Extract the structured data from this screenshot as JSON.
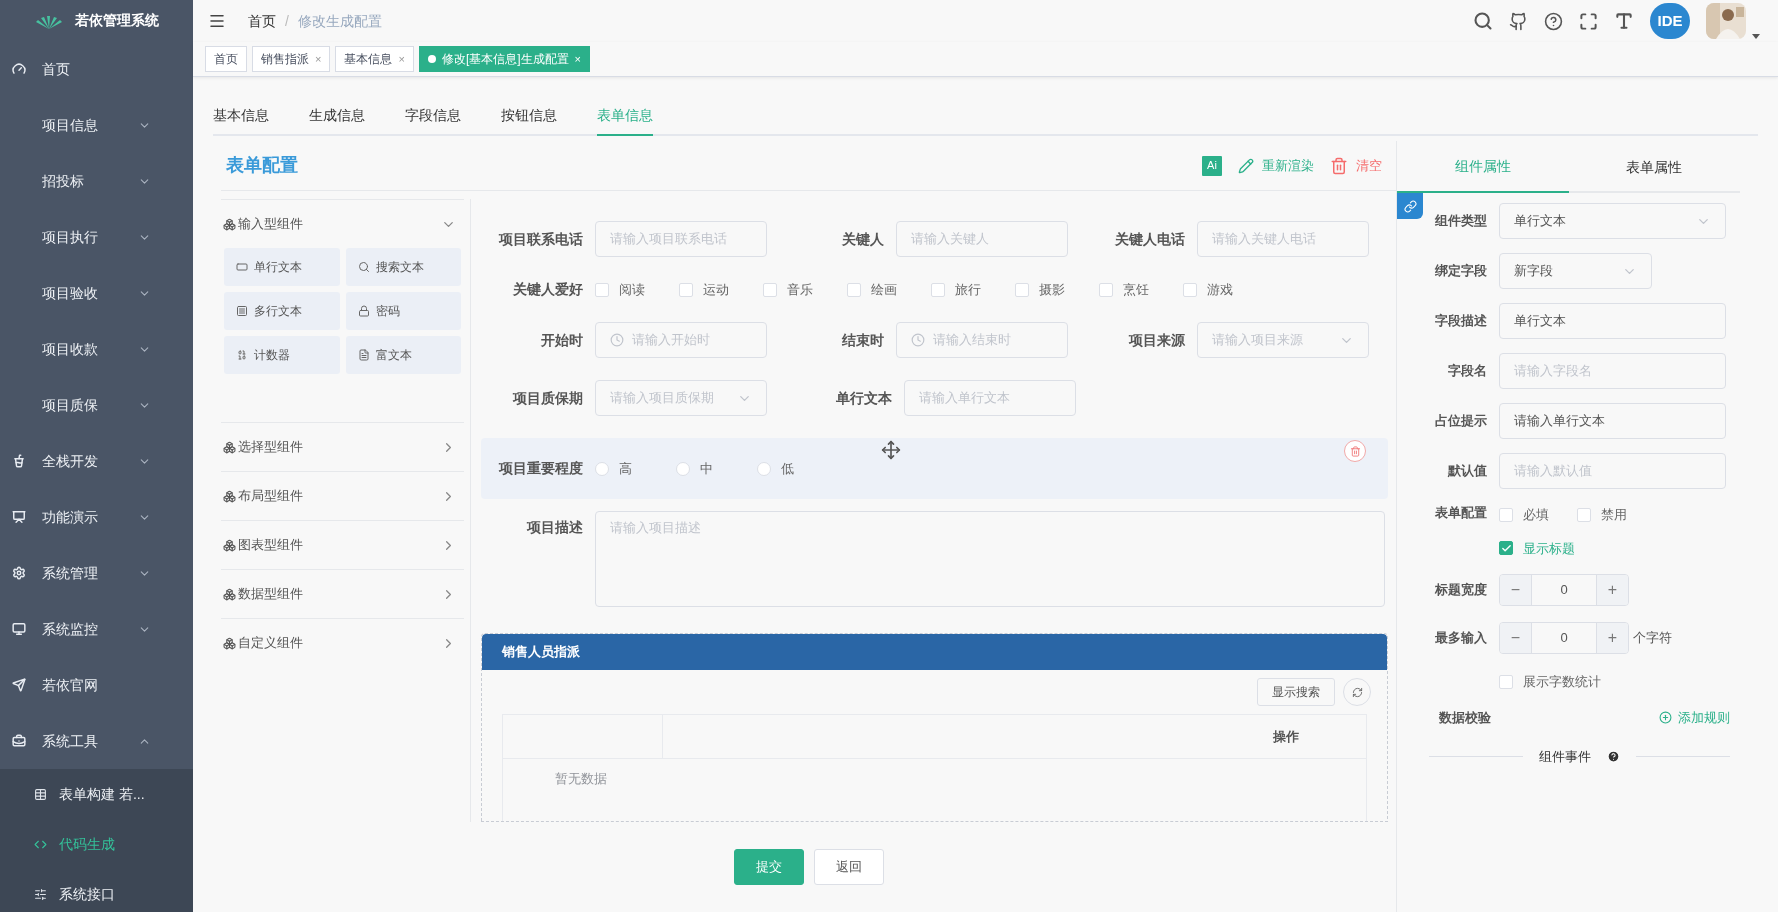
{
  "app": {
    "title": "若依管理系统"
  },
  "sidebar": {
    "items": [
      {
        "label": "首页",
        "kind": "top"
      },
      {
        "label": "项目信息",
        "kind": "plain",
        "expanded": false
      },
      {
        "label": "招投标",
        "kind": "plain",
        "expanded": false
      },
      {
        "label": "项目执行",
        "kind": "plain",
        "expanded": false
      },
      {
        "label": "项目验收",
        "kind": "plain",
        "expanded": false
      },
      {
        "label": "项目收款",
        "kind": "plain",
        "expanded": false
      },
      {
        "label": "项目质保",
        "kind": "plain",
        "expanded": false
      },
      {
        "label": "全栈开发",
        "kind": "top",
        "expanded": false
      },
      {
        "label": "功能演示",
        "kind": "top",
        "expanded": false
      },
      {
        "label": "系统管理",
        "kind": "top",
        "expanded": false
      },
      {
        "label": "系统监控",
        "kind": "top",
        "expanded": false
      },
      {
        "label": "若依官网",
        "kind": "top"
      },
      {
        "label": "系统工具",
        "kind": "top",
        "expanded": true,
        "children": [
          {
            "label": "表单构建 若...",
            "selected": false
          },
          {
            "label": "代码生成",
            "selected": true
          },
          {
            "label": "系统接口",
            "selected": false
          }
        ]
      }
    ]
  },
  "navbar": {
    "breadcrumb": [
      {
        "label": "首页",
        "current": false
      },
      {
        "label": "修改生成配置",
        "current": true
      }
    ],
    "separator": "/",
    "ide_badge": "IDE"
  },
  "tags": [
    {
      "label": "首页",
      "selected": false
    },
    {
      "label": "销售指派",
      "selected": false,
      "close": "×"
    },
    {
      "label": "基本信息",
      "selected": false,
      "close": "×"
    },
    {
      "label": "修改[基本信息]生成配置",
      "selected": true,
      "close": "×"
    }
  ],
  "tabs": [
    {
      "label": "基本信息",
      "selected": false
    },
    {
      "label": "生成信息",
      "selected": false
    },
    {
      "label": "字段信息",
      "selected": false
    },
    {
      "label": "按钮信息",
      "selected": false
    },
    {
      "label": "表单信息",
      "selected": true
    }
  ],
  "form_config": {
    "title": "表单配置",
    "actions": [
      {
        "kind": "ai",
        "label": "Ai"
      },
      {
        "kind": "rerender",
        "label": "重新渲染"
      },
      {
        "kind": "clear",
        "label": "清空"
      }
    ]
  },
  "component_groups": [
    {
      "label": "输入型组件",
      "expanded": true,
      "items": [
        "单行文本",
        "搜索文本",
        "多行文本",
        "密码",
        "计数器",
        "富文本"
      ]
    },
    {
      "label": "选择型组件",
      "expanded": false
    },
    {
      "label": "布局型组件",
      "expanded": false
    },
    {
      "label": "图表型组件",
      "expanded": false
    },
    {
      "label": "数据型组件",
      "expanded": false
    },
    {
      "label": "自定义组件",
      "expanded": false
    }
  ],
  "form_rows": [
    {
      "active": false,
      "fields": [
        {
          "kind": "input",
          "label": "项目联系电话",
          "placeholder": "请输入项目联系电话"
        },
        {
          "kind": "input",
          "label": "关键人",
          "placeholder": "请输入关键人"
        },
        {
          "kind": "input",
          "label": "关键人电话",
          "placeholder": "请输入关键人电话"
        }
      ]
    },
    {
      "active": false,
      "fields": [
        {
          "kind": "checkboxes",
          "label": "关键人爱好",
          "options": [
            {
              "label": "阅读",
              "checked": false
            },
            {
              "label": "运动",
              "checked": false
            },
            {
              "label": "音乐",
              "checked": false
            },
            {
              "label": "绘画",
              "checked": false
            },
            {
              "label": "旅行",
              "checked": false
            },
            {
              "label": "摄影",
              "checked": false
            },
            {
              "label": "烹饪",
              "checked": false
            },
            {
              "label": "游戏",
              "checked": false
            }
          ]
        }
      ]
    },
    {
      "active": false,
      "fields": [
        {
          "kind": "date",
          "label": "开始时",
          "placeholder": "请输入开始时"
        },
        {
          "kind": "date",
          "label": "结束时",
          "placeholder": "请输入结束时"
        },
        {
          "kind": "select",
          "label": "项目来源",
          "placeholder": "请输入项目来源"
        }
      ]
    },
    {
      "active": false,
      "fields": [
        {
          "kind": "select",
          "label": "项目质保期",
          "placeholder": "请输入项目质保期"
        },
        {
          "kind": "input",
          "label": "单行文本",
          "placeholder": "请输入单行文本"
        }
      ]
    },
    {
      "active": true,
      "fields": [
        {
          "kind": "radios",
          "label": "项目重要程度",
          "options": [
            {
              "label": "高",
              "selected": false
            },
            {
              "label": "中",
              "selected": false
            },
            {
              "label": "低",
              "selected": false
            }
          ]
        }
      ]
    },
    {
      "active": false,
      "fields": [
        {
          "kind": "textarea",
          "label": "项目描述",
          "placeholder": "请输入项目描述"
        }
      ]
    }
  ],
  "table_card": {
    "title": "销售人员指派",
    "search_button": "显示搜索",
    "columns": [
      {
        "label": "操作"
      }
    ],
    "empty_text": "暂无数据"
  },
  "props_tabs": [
    {
      "label": "组件属性",
      "selected": true
    },
    {
      "label": "表单属性",
      "selected": false
    }
  ],
  "props": [
    {
      "kind": "select",
      "label": "组件类型",
      "value": "单行文本",
      "wide": true
    },
    {
      "kind": "select",
      "label": "绑定字段",
      "value": "新字段",
      "wide": false
    },
    {
      "kind": "input",
      "label": "字段描述",
      "value": "单行文本"
    },
    {
      "kind": "input",
      "label": "字段名",
      "placeholder": "请输入字段名"
    },
    {
      "kind": "input",
      "label": "占位提示",
      "value": "请输入单行文本"
    },
    {
      "kind": "input",
      "label": "默认值",
      "placeholder": "请输入默认值"
    },
    {
      "kind": "checks",
      "label": "表单配置",
      "options": [
        {
          "label": "必填",
          "checked": false
        },
        {
          "label": "禁用",
          "checked": false
        },
        {
          "label": "显示标题",
          "checked": true
        }
      ]
    },
    {
      "kind": "stepper",
      "label": "标题宽度",
      "value": "0",
      "minus": "−",
      "plus": "+"
    },
    {
      "kind": "stepper",
      "label": "最多输入",
      "value": "0",
      "minus": "−",
      "plus": "+",
      "suffix": "个字符"
    },
    {
      "kind": "checks",
      "options": [
        {
          "label": "展示字数统计",
          "checked": false
        }
      ]
    },
    {
      "kind": "link",
      "label": "数据校验",
      "link": "添加规则"
    },
    {
      "kind": "divider",
      "label": "组件事件"
    }
  ],
  "footer": {
    "buttons": [
      {
        "label": "提交",
        "primary": true
      },
      {
        "label": "返回",
        "primary": false
      }
    ]
  }
}
